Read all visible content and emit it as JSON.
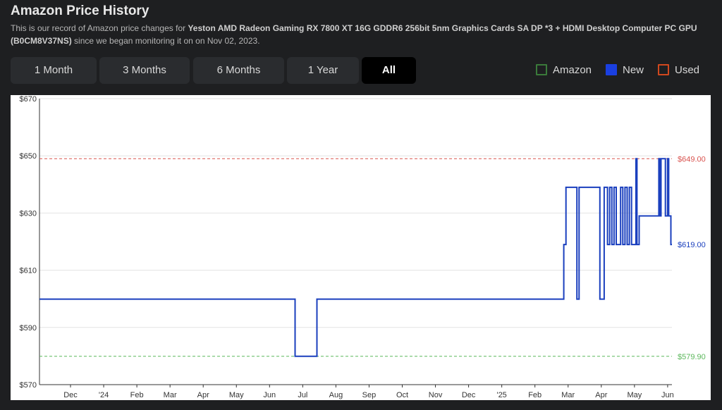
{
  "header": {
    "title": "Amazon Price History",
    "desc_prefix": "This is our record of Amazon price changes for ",
    "product_name": "Yeston AMD Radeon Gaming RX 7800 XT 16G GDDR6 256bit 5nm Graphics Cards SA DP *3 + HDMI Desktop Computer PC GPU (B0CM8V37NS)",
    "desc_suffix": " since we began monitoring it on on Nov 02, 2023."
  },
  "range_buttons": [
    {
      "label": "1 Month"
    },
    {
      "label": "3 Months"
    },
    {
      "label": "6 Months"
    },
    {
      "label": "1 Year"
    },
    {
      "label": "All",
      "active": true
    }
  ],
  "legend": [
    {
      "label": "Amazon",
      "color": "#3a7a3a"
    },
    {
      "label": "New",
      "color": "#1a3fe0"
    },
    {
      "label": "Used",
      "color": "#d0481e"
    }
  ],
  "chart_data": {
    "type": "line",
    "y_ticks": [
      "$670",
      "$650",
      "$630",
      "$610",
      "$590",
      "$570"
    ],
    "ylim": [
      570,
      670
    ],
    "x_ticks": [
      "Dec",
      "'24",
      "Feb",
      "Mar",
      "Apr",
      "May",
      "Jun",
      "Jul",
      "Aug",
      "Sep",
      "Oct",
      "Nov",
      "Dec",
      "'25",
      "Feb",
      "Mar",
      "Apr",
      "May",
      "Jun"
    ],
    "x_range": [
      "2023-11-02",
      "2025-06-03"
    ],
    "reference_lines": [
      {
        "value": 649.0,
        "label": "$649.00",
        "color": "#d9534f"
      },
      {
        "value": 579.9,
        "label": "$579.90",
        "color": "#5cb85c"
      }
    ],
    "end_label": {
      "value": 619.0,
      "label": "$619.00",
      "color": "#1a3fbe"
    },
    "series": [
      {
        "name": "New",
        "color": "#1a3fbe",
        "points": [
          [
            "2023-11-02",
            599.9
          ],
          [
            "2024-06-23",
            599.9
          ],
          [
            "2024-06-23",
            579.9
          ],
          [
            "2024-07-13",
            579.9
          ],
          [
            "2024-07-13",
            599.9
          ],
          [
            "2025-02-24",
            599.9
          ],
          [
            "2025-02-24",
            619
          ],
          [
            "2025-02-26",
            619
          ],
          [
            "2025-02-26",
            639
          ],
          [
            "2025-03-08",
            639
          ],
          [
            "2025-03-08",
            599.9
          ],
          [
            "2025-03-10",
            599.9
          ],
          [
            "2025-03-10",
            639
          ],
          [
            "2025-03-29",
            639
          ],
          [
            "2025-03-29",
            599.9
          ],
          [
            "2025-04-02",
            599.9
          ],
          [
            "2025-04-02",
            639
          ],
          [
            "2025-04-05",
            639
          ],
          [
            "2025-04-05",
            619
          ],
          [
            "2025-04-07",
            619
          ],
          [
            "2025-04-07",
            639
          ],
          [
            "2025-04-09",
            639
          ],
          [
            "2025-04-09",
            619
          ],
          [
            "2025-04-11",
            619
          ],
          [
            "2025-04-11",
            639
          ],
          [
            "2025-04-13",
            639
          ],
          [
            "2025-04-13",
            619
          ],
          [
            "2025-04-17",
            619
          ],
          [
            "2025-04-17",
            639
          ],
          [
            "2025-04-19",
            639
          ],
          [
            "2025-04-19",
            619
          ],
          [
            "2025-04-21",
            619
          ],
          [
            "2025-04-21",
            639
          ],
          [
            "2025-04-23",
            639
          ],
          [
            "2025-04-23",
            619
          ],
          [
            "2025-04-25",
            619
          ],
          [
            "2025-04-25",
            639
          ],
          [
            "2025-04-27",
            639
          ],
          [
            "2025-04-27",
            619
          ],
          [
            "2025-05-01",
            619
          ],
          [
            "2025-05-01",
            649
          ],
          [
            "2025-05-02",
            649
          ],
          [
            "2025-05-02",
            619
          ],
          [
            "2025-05-04",
            619
          ],
          [
            "2025-05-04",
            629
          ],
          [
            "2025-05-22",
            629
          ],
          [
            "2025-05-22",
            649
          ],
          [
            "2025-05-23",
            649
          ],
          [
            "2025-05-23",
            629
          ],
          [
            "2025-05-24",
            629
          ],
          [
            "2025-05-24",
            649
          ],
          [
            "2025-05-28",
            649
          ],
          [
            "2025-05-28",
            629
          ],
          [
            "2025-05-30",
            629
          ],
          [
            "2025-05-30",
            649
          ],
          [
            "2025-05-31",
            649
          ],
          [
            "2025-05-31",
            629
          ],
          [
            "2025-06-02",
            629
          ],
          [
            "2025-06-02",
            619
          ],
          [
            "2025-06-03",
            619
          ]
        ]
      }
    ]
  }
}
